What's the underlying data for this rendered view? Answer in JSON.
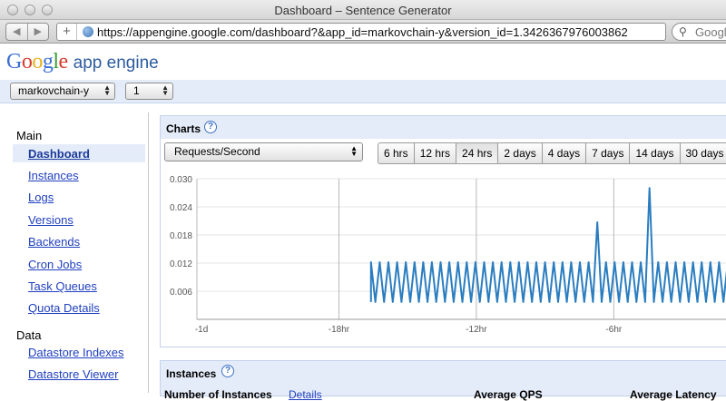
{
  "window": {
    "title": "Dashboard – Sentence Generator"
  },
  "browser": {
    "url": "https://appengine.google.com/dashboard?&app_id=markovchain-y&version_id=1.3426367976003862",
    "search_placeholder": "Google",
    "new_tab": "+",
    "back": "◀",
    "forward": "▶"
  },
  "header": {
    "logo": {
      "letters": [
        "G",
        "o",
        "o",
        "g",
        "l",
        "e"
      ],
      "colors": [
        "#3c6fd4",
        "#d53c2a",
        "#e7b11d",
        "#3c6fd4",
        "#3a9b36",
        "#d53c2a"
      ],
      "suffix": "app engine"
    },
    "app_selector": "markovchain-y",
    "version_selector": "1"
  },
  "sidebar": {
    "main_heading": "Main",
    "main_items": [
      "Dashboard",
      "Instances",
      "Logs",
      "Versions",
      "Backends",
      "Cron Jobs",
      "Task Queues",
      "Quota Details"
    ],
    "active": "Dashboard",
    "data_heading": "Data",
    "data_items": [
      "Datastore Indexes",
      "Datastore Viewer"
    ]
  },
  "charts": {
    "title": "Charts",
    "help": "?",
    "metric": "Requests/Second",
    "ranges": [
      "6 hrs",
      "12 hrs",
      "24 hrs",
      "2 days",
      "4 days",
      "7 days",
      "14 days",
      "30 days"
    ],
    "selected_range": "24 hrs"
  },
  "instances": {
    "title": "Instances",
    "help": "?",
    "col_number": "Number of Instances",
    "details_link": "Details",
    "col_qps": "Average QPS",
    "col_latency": "Average Latency"
  },
  "chart_data": {
    "type": "line",
    "title": "",
    "xlabel": "",
    "ylabel": "",
    "x_ticks": [
      "-1d",
      "-18hr",
      "-12hr",
      "-6hr"
    ],
    "x_tick_hours": [
      -24,
      -18,
      -12,
      -6
    ],
    "xlim_hours": [
      -24.2,
      -1.1
    ],
    "y_ticks": [
      "0.030",
      "0.024",
      "0.018",
      "0.012",
      "0.006"
    ],
    "ylim": [
      0,
      0.03
    ],
    "grid": true,
    "color": "#2a7dc0",
    "series": [
      {
        "pattern": "spikes every ~0.4hr between 0.0037 and 0.0122 starting at -16.6hr",
        "start_hour": -16.6,
        "period_hours": 0.38,
        "low": 0.0037,
        "high": 0.0122,
        "outliers": [
          {
            "hour": -6.7,
            "value": 0.0207
          },
          {
            "hour": -4.3,
            "value": 0.028
          }
        ]
      }
    ]
  }
}
